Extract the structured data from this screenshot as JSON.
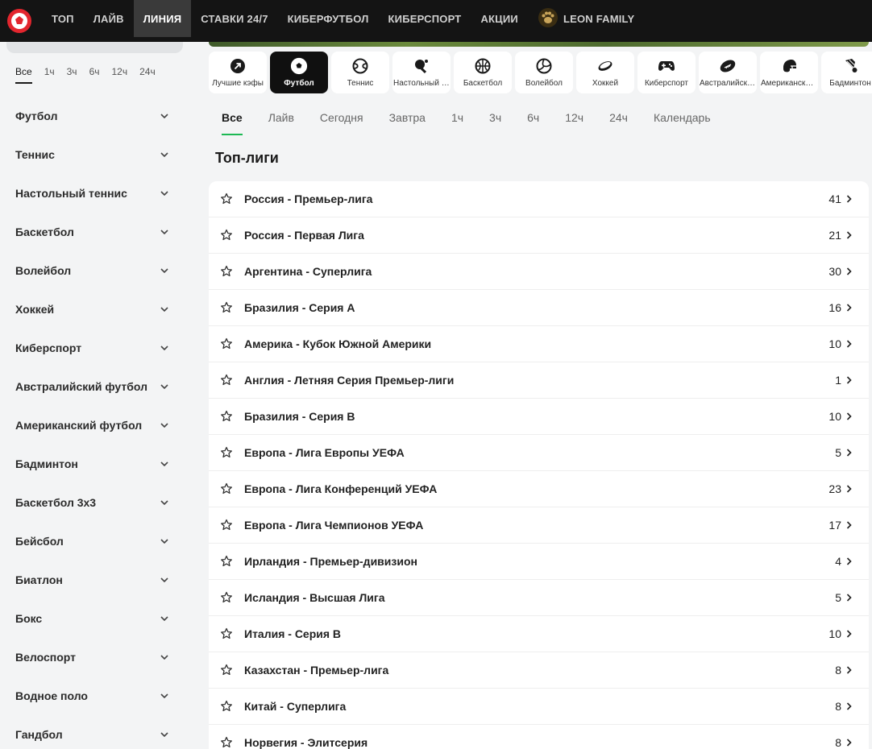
{
  "nav": {
    "items": [
      {
        "label": "ТОП"
      },
      {
        "label": "ЛАЙВ"
      },
      {
        "label": "ЛИНИЯ"
      },
      {
        "label": "СТАВКИ 24/7"
      },
      {
        "label": "КИБЕРФУТБОЛ"
      },
      {
        "label": "КИБЕРСПОРТ"
      },
      {
        "label": "АКЦИИ"
      }
    ],
    "family_label": "LEON FAMILY",
    "active_index": 2,
    "colors": {
      "bar": "#141414",
      "active": "#3a3a3a",
      "brand_red": "#e3262e",
      "paw": "#c9a55a"
    }
  },
  "sidebar": {
    "time_filters": [
      "Все",
      "1ч",
      "3ч",
      "6ч",
      "12ч",
      "24ч"
    ],
    "sports": [
      "Футбол",
      "Теннис",
      "Настольный теннис",
      "Баскетбол",
      "Волейбол",
      "Хоккей",
      "Киберспорт",
      "Австралийский футбол",
      "Американский футбол",
      "Бадминтон",
      "Баскетбол 3x3",
      "Бейсбол",
      "Биатлон",
      "Бокс",
      "Велоспорт",
      "Водное поло",
      "Гандбол"
    ]
  },
  "tiles": [
    {
      "label": "Лучшие кэфы",
      "icon": "best-odds-icon"
    },
    {
      "label": "Футбол",
      "icon": "football-icon"
    },
    {
      "label": "Теннис",
      "icon": "tennis-icon"
    },
    {
      "label": "Настольный теннис",
      "icon": "table-tennis-icon"
    },
    {
      "label": "Баскетбол",
      "icon": "basketball-icon"
    },
    {
      "label": "Волейбол",
      "icon": "volleyball-icon"
    },
    {
      "label": "Хоккей",
      "icon": "hockey-icon"
    },
    {
      "label": "Киберспорт",
      "icon": "gamepad-icon"
    },
    {
      "label": "Австралийский футбол",
      "icon": "aussie-football-icon"
    },
    {
      "label": "Американский футбол",
      "icon": "american-football-icon"
    },
    {
      "label": "Бадминтон",
      "icon": "badminton-icon"
    }
  ],
  "period_tabs": [
    "Все",
    "Лайв",
    "Сегодня",
    "Завтра",
    "1ч",
    "3ч",
    "6ч",
    "12ч",
    "24ч",
    "Календарь"
  ],
  "section_title": "Топ-лиги",
  "leagues": [
    {
      "name": "Россия - Премьер-лига",
      "count": "41"
    },
    {
      "name": "Россия - Первая Лига",
      "count": "21"
    },
    {
      "name": "Аргентина - Суперлига",
      "count": "30"
    },
    {
      "name": "Бразилия - Серия А",
      "count": "16"
    },
    {
      "name": "Америка - Кубок Южной Америки",
      "count": "10"
    },
    {
      "name": "Англия - Летняя Серия Премьер-лиги",
      "count": "1"
    },
    {
      "name": "Бразилия - Серия В",
      "count": "10"
    },
    {
      "name": "Европа - Лига Европы УЕФА",
      "count": "5"
    },
    {
      "name": "Европа - Лига Конференций УЕФА",
      "count": "23"
    },
    {
      "name": "Европа - Лига Чемпионов УЕФА",
      "count": "17"
    },
    {
      "name": "Ирландия - Премьер-дивизион",
      "count": "4"
    },
    {
      "name": "Исландия - Высшая Лига",
      "count": "5"
    },
    {
      "name": "Италия - Серия В",
      "count": "10"
    },
    {
      "name": "Казахстан - Премьер-лига",
      "count": "8"
    },
    {
      "name": "Китай - Суперлига",
      "count": "8"
    },
    {
      "name": "Норвегия - Элитсерия",
      "count": "8"
    }
  ]
}
